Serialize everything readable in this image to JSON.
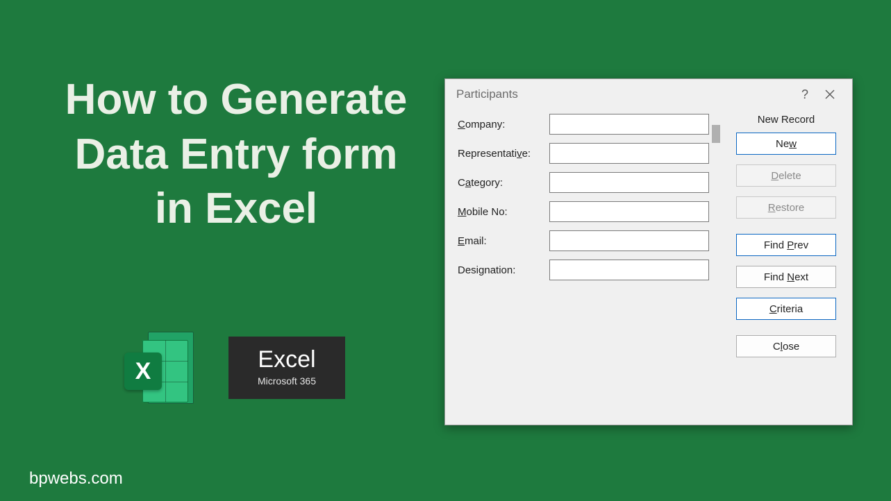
{
  "hero": {
    "title": "How to Generate Data Entry form in Excel"
  },
  "logos": {
    "excel_icon_letter": "X",
    "m365": {
      "name": "Excel",
      "sub": "Microsoft 365"
    }
  },
  "footer": {
    "site": "bpwebs.com"
  },
  "dialog": {
    "title": "Participants",
    "help": "?",
    "status": "New Record",
    "fields": [
      {
        "label_pre": "",
        "label_u": "C",
        "label_post": "ompany:",
        "value": ""
      },
      {
        "label_pre": "Representati",
        "label_u": "v",
        "label_post": "e:",
        "value": ""
      },
      {
        "label_pre": "C",
        "label_u": "a",
        "label_post": "tegory:",
        "value": ""
      },
      {
        "label_pre": "",
        "label_u": "M",
        "label_post": "obile No:",
        "value": ""
      },
      {
        "label_pre": "",
        "label_u": "E",
        "label_post": "mail:",
        "value": ""
      },
      {
        "label_pre": "Desi",
        "label_u": "g",
        "label_post": "nation:",
        "value": ""
      }
    ],
    "buttons": {
      "new": {
        "pre": "Ne",
        "u": "w",
        "post": ""
      },
      "delete": {
        "pre": "",
        "u": "D",
        "post": "elete"
      },
      "restore": {
        "pre": "",
        "u": "R",
        "post": "estore"
      },
      "find_prev": {
        "pre": "Find ",
        "u": "P",
        "post": "rev"
      },
      "find_next": {
        "pre": "Find ",
        "u": "N",
        "post": "ext"
      },
      "criteria": {
        "pre": "",
        "u": "C",
        "post": "riteria"
      },
      "close": {
        "pre": "C",
        "u": "l",
        "post": "ose"
      }
    }
  }
}
